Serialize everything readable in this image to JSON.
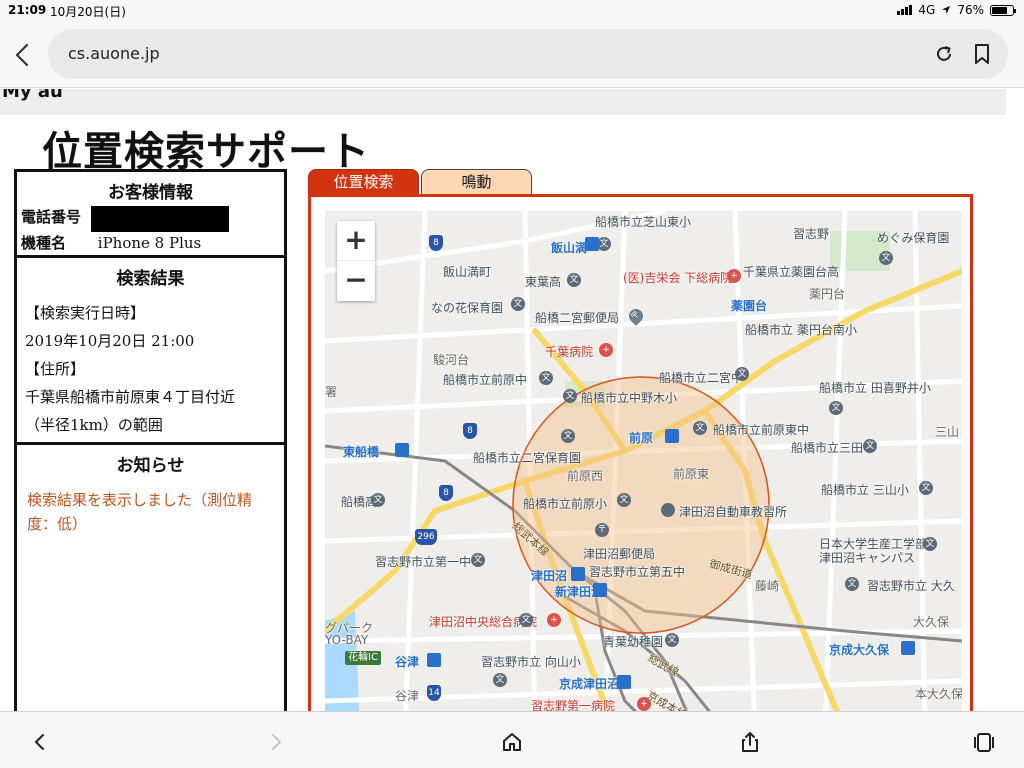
{
  "status_bar": {
    "time": "21:09",
    "date": "10月20日(日)",
    "network": "4G",
    "battery_text": "76%",
    "battery_level": 0.76
  },
  "browser": {
    "url": "cs.auone.jp"
  },
  "page": {
    "header_text": "My au",
    "title": "位置検索サポート"
  },
  "customer": {
    "heading": "お客様情報",
    "phone_label": "電話番号",
    "model_label": "機種名",
    "model_value": "iPhone 8 Plus"
  },
  "result": {
    "heading": "検索結果",
    "time_label": "【検索実行日時】",
    "time_value": "2019年10月20日 21:00",
    "address_label": "【住所】",
    "address_value": "千葉県船橋市前原東４丁目付近",
    "range_text": "（半径1km）の範囲"
  },
  "notice": {
    "heading": "お知らせ",
    "message": "検索結果を表示しました（測位精度：低）"
  },
  "tabs": [
    {
      "label": "位置検索",
      "active": true
    },
    {
      "label": "鳴動",
      "active": false
    }
  ],
  "map": {
    "zoom_in": "+",
    "zoom_out": "−",
    "circle_color": "#d9541e",
    "labels": {
      "l01": "船橋市立芝山東小",
      "l02": "習志野",
      "l03": "めぐみ保育園",
      "l04": "飯山満",
      "l05": "飯山満町",
      "l06": "東葉高",
      "l07": "(医)吉栄会 下総病院",
      "l08": "千葉県立薬園台高",
      "l09": "薬円台",
      "l10": "なの花保育園",
      "l11": "薬園台",
      "l12": "船橋二宮郵便局",
      "l13": "船橋市立 薬円台南小",
      "l14": "千葉病院",
      "l15": "駿河台",
      "l16": "船橋市立前原中",
      "l17": "船橋市立二宮中",
      "l18": "船橋市立中野木小",
      "l19": "船橋市立 田喜野井小",
      "l20": "船橋市立前原東中",
      "l21": "三山",
      "l22": "前原",
      "l23": "船橋市立三田中",
      "l24": "東船橋",
      "l25": "船橋市立二宮保育園",
      "l26": "前原西",
      "l27": "前原東",
      "l28": "船橋市立 三山小",
      "l29": "船橋高",
      "l30": "船橋市立前原小",
      "l31": "津田沼自動車教習所",
      "l32": "総武本線",
      "l33": "日本大学生産工学部",
      "l34": "津田沼キャンパス",
      "l35": "習志野市立第一中",
      "l36": "津田沼郵便局",
      "l37": "御成街道",
      "l38": "津田沼",
      "l39": "習志野市立第五中",
      "l40": "藤崎",
      "l41": "習志野市立 大久",
      "l42": "新津田沼",
      "l43": "大久保",
      "l44": "津田沼中央総合病院",
      "l45": "グパーク",
      "l46": "YO-BAY",
      "l47": "青葉幼稚園",
      "l48": "京成大久保",
      "l49": "花輪IC",
      "l50": "谷津",
      "l51": "習志野市立 向山小",
      "l52": "総武線",
      "l53": "京成津田沼",
      "l54": "本大久保",
      "l55": "習志野第一病院",
      "l56": "京成本線",
      "l57": "谷津",
      "l58": "署"
    }
  }
}
